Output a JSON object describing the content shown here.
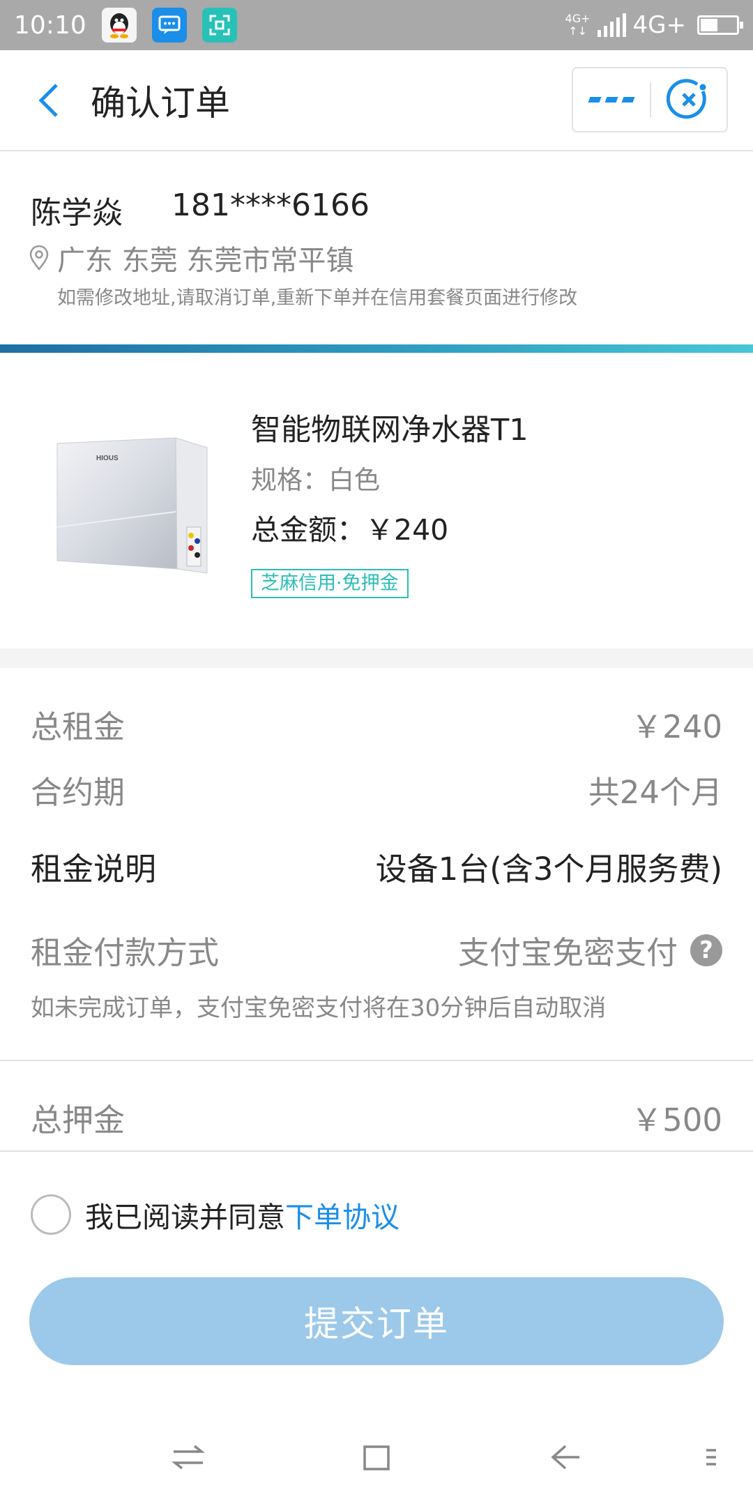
{
  "status_bar": {
    "time": "10:10",
    "network_small": "4G+",
    "network_small_sub": "↑↓",
    "network": "4G+",
    "battery_level": 0.45
  },
  "header": {
    "title": "确认订单"
  },
  "address": {
    "name": "陈学焱",
    "phone": "181****6166",
    "location": "广东 东莞 东莞市常平镇",
    "note": "如需修改地址,请取消订单,重新下单并在信用套餐页面进行修改"
  },
  "product": {
    "image_brand": "HIOUS",
    "name": "智能物联网净水器T1",
    "spec": "规格：白色",
    "total": "总金额：￥240",
    "badge": "芝麻信用·免押金"
  },
  "details": {
    "rent_label": "总租金",
    "rent_value": "￥240",
    "term_label": "合约期",
    "term_value": "共24个月",
    "desc_label": "租金说明",
    "desc_value": "设备1台(含3个月服务费)",
    "pay_label": "租金付款方式",
    "pay_value": "支付宝免密支付",
    "pay_help": "?",
    "pay_note": "如未完成订单，支付宝免密支付将在30分钟后自动取消",
    "deposit_label": "总押金",
    "deposit_value": "￥500"
  },
  "agreement": {
    "text": "我已阅读并同意",
    "link": "下单协议"
  },
  "submit_label": "提交订单",
  "colors": {
    "accent": "#1a8ee8",
    "submit_disabled": "#9cc9e9",
    "badge": "#2bbdb4"
  }
}
